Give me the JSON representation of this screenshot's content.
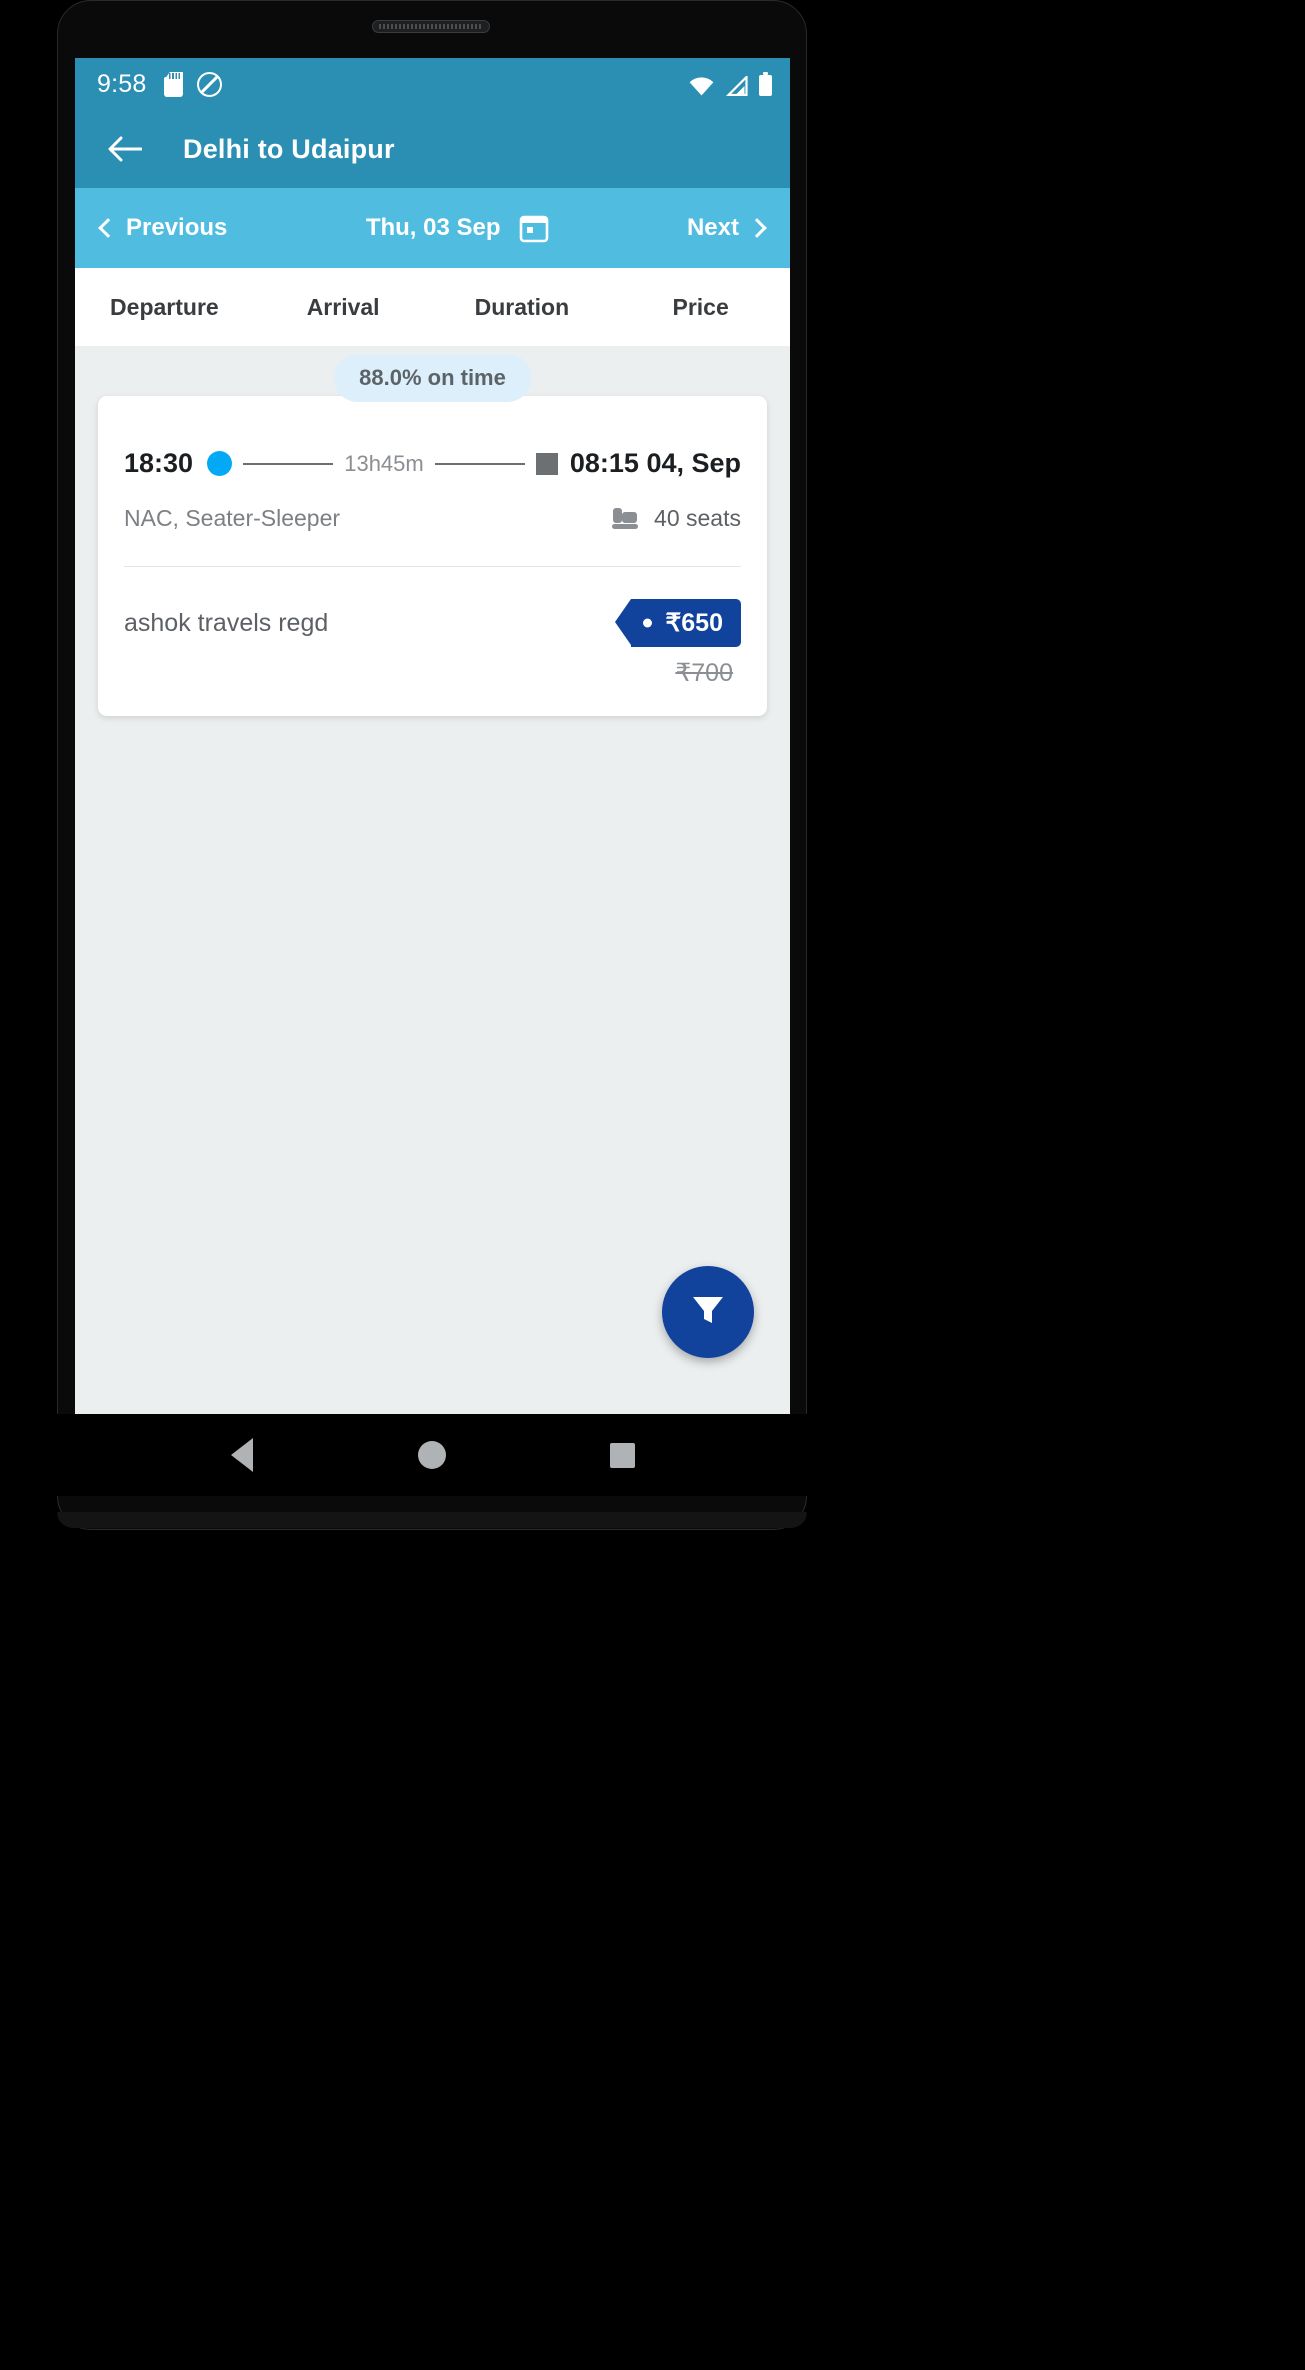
{
  "statusbar": {
    "time": "9:58",
    "icons": [
      "sd-card-icon",
      "do-not-disturb-icon",
      "wifi-icon",
      "cellular-signal-icon",
      "battery-icon"
    ]
  },
  "appbar": {
    "back_icon": "back-arrow-icon",
    "title": "Delhi to Udaipur"
  },
  "datebar": {
    "previous_label": "Previous",
    "date": "Thu, 03 Sep",
    "next_label": "Next",
    "calendar_icon": "calendar-icon"
  },
  "columns": [
    {
      "label": "Departure"
    },
    {
      "label": "Arrival"
    },
    {
      "label": "Duration"
    },
    {
      "label": "Price"
    }
  ],
  "results": [
    {
      "on_time_badge": "88.0% on time",
      "departure_time": "18:30",
      "duration": "13h45m",
      "arrival_time": "08:15 04, Sep",
      "bus_type": "NAC, Seater-Sleeper",
      "seats": "40 seats",
      "seat_icon": "seat-icon",
      "operator": "ashok travels regd",
      "price": "₹650",
      "price_original": "₹700"
    }
  ],
  "fab": {
    "icon": "filter-funnel-icon"
  },
  "navbar": {
    "back": "nav-back-icon",
    "home": "nav-home-icon",
    "recents": "nav-recents-icon"
  },
  "colors": {
    "statusbar": "#2b8fb3",
    "appbar": "#2b8fb3",
    "datebar": "#4fbce0",
    "accent_blue": "#03a9f4",
    "price_tag": "#11429c",
    "badge_bg": "#ddeffa",
    "content_bg": "#eceff0"
  }
}
